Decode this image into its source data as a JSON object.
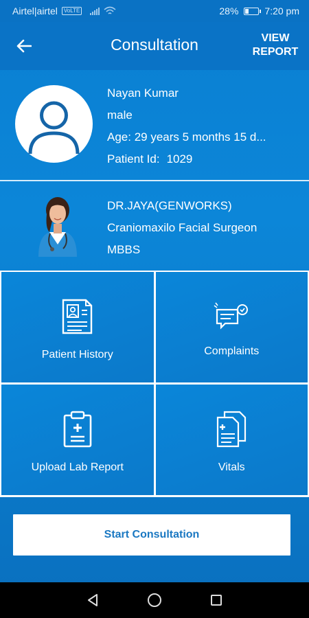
{
  "status_bar": {
    "carrier": "Airtel|airtel",
    "volte": "VoLTE",
    "battery": "28%",
    "battery_level": 0.28,
    "time": "7:20 pm"
  },
  "header": {
    "title": "Consultation",
    "view_report_line1": "VIEW",
    "view_report_line2": "REPORT"
  },
  "patient": {
    "name": "Nayan Kumar",
    "gender": "male",
    "age": "Age: 29 years 5 months 15 d...",
    "id_label": "Patient Id:",
    "id_value": "1029"
  },
  "doctor": {
    "name": "DR.JAYA(GENWORKS)",
    "specialty": "Craniomaxilo  Facial Surgeon",
    "degree": "MBBS"
  },
  "tiles": [
    {
      "label": "Patient History",
      "icon": "patient-history-icon"
    },
    {
      "label": "Complaints",
      "icon": "complaints-icon"
    },
    {
      "label": "Upload Lab Report",
      "icon": "clipboard-icon"
    },
    {
      "label": "Vitals",
      "icon": "vitals-document-icon"
    }
  ],
  "actions": {
    "start_consultation": "Start Consultation"
  },
  "colors": {
    "primary": "#0b7ed0",
    "header": "#0a73c6",
    "button_text": "#1a78c2"
  }
}
